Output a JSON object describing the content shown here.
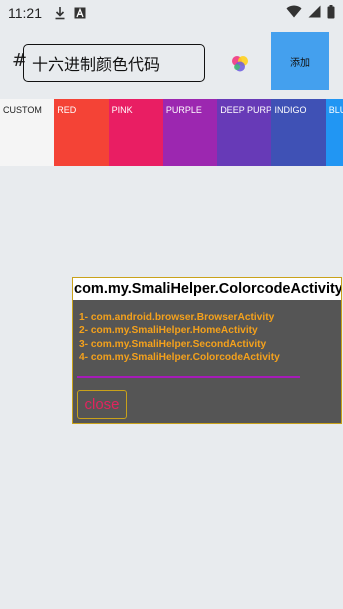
{
  "status_bar": {
    "time": "11:21",
    "icons": [
      "download-icon",
      "font-icon",
      "wifi-icon",
      "signal-icon",
      "battery-icon"
    ]
  },
  "hex_row": {
    "hash": "#",
    "input_value": "十六进制颜色代码",
    "add_label": "添加"
  },
  "swatches": [
    {
      "label": "CUSTOM",
      "color": "#f5f5f5"
    },
    {
      "label": "RED",
      "color": "#f44336"
    },
    {
      "label": "PINK",
      "color": "#e91e63"
    },
    {
      "label": "PURPLE",
      "color": "#9c27b0"
    },
    {
      "label": "DEEP PURPLE",
      "color": "#673ab7"
    },
    {
      "label": "INDIGO",
      "color": "#3f51b5"
    },
    {
      "label": "BLUE",
      "color": "#2196f3"
    }
  ],
  "dialog": {
    "title": "com.my.SmaliHelper.ColorcodeActivity",
    "activities": [
      "1- com.android.browser.BrowserActivity",
      "2- com.my.SmaliHelper.HomeActivity",
      "3- com.my.SmaliHelper.SecondActivity",
      "4- com.my.SmaliHelper.ColorcodeActivity"
    ],
    "close_label": "close"
  }
}
